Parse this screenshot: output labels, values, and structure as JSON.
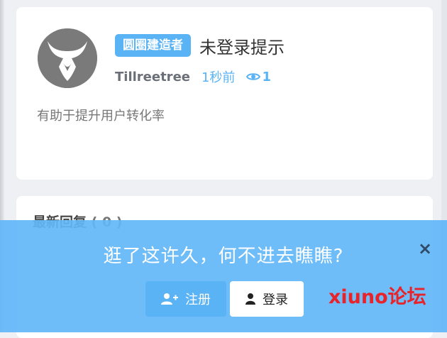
{
  "post": {
    "board_badge": "圆圈建造者",
    "title": "未登录提示",
    "author": "Tillreetree",
    "time": "1秒前",
    "views": "1",
    "excerpt": "有助于提升用户转化率"
  },
  "replies": {
    "heading": "最新回复",
    "count": "( 0 )"
  },
  "login_prompt": {
    "message": "逛了这许久，何不进去瞧瞧?",
    "register_label": "注册",
    "login_label": "登录",
    "close_label": "×",
    "brand": "xiuno论坛"
  },
  "icons": {
    "avatar": "horned-helmet-icon",
    "views": "eye-icon",
    "register": "user-plus-icon",
    "login": "user-icon",
    "close": "close-icon"
  },
  "colors": {
    "accent": "#5ab3f5",
    "overlay": "#62b7f8",
    "brand": "#e8232a"
  }
}
